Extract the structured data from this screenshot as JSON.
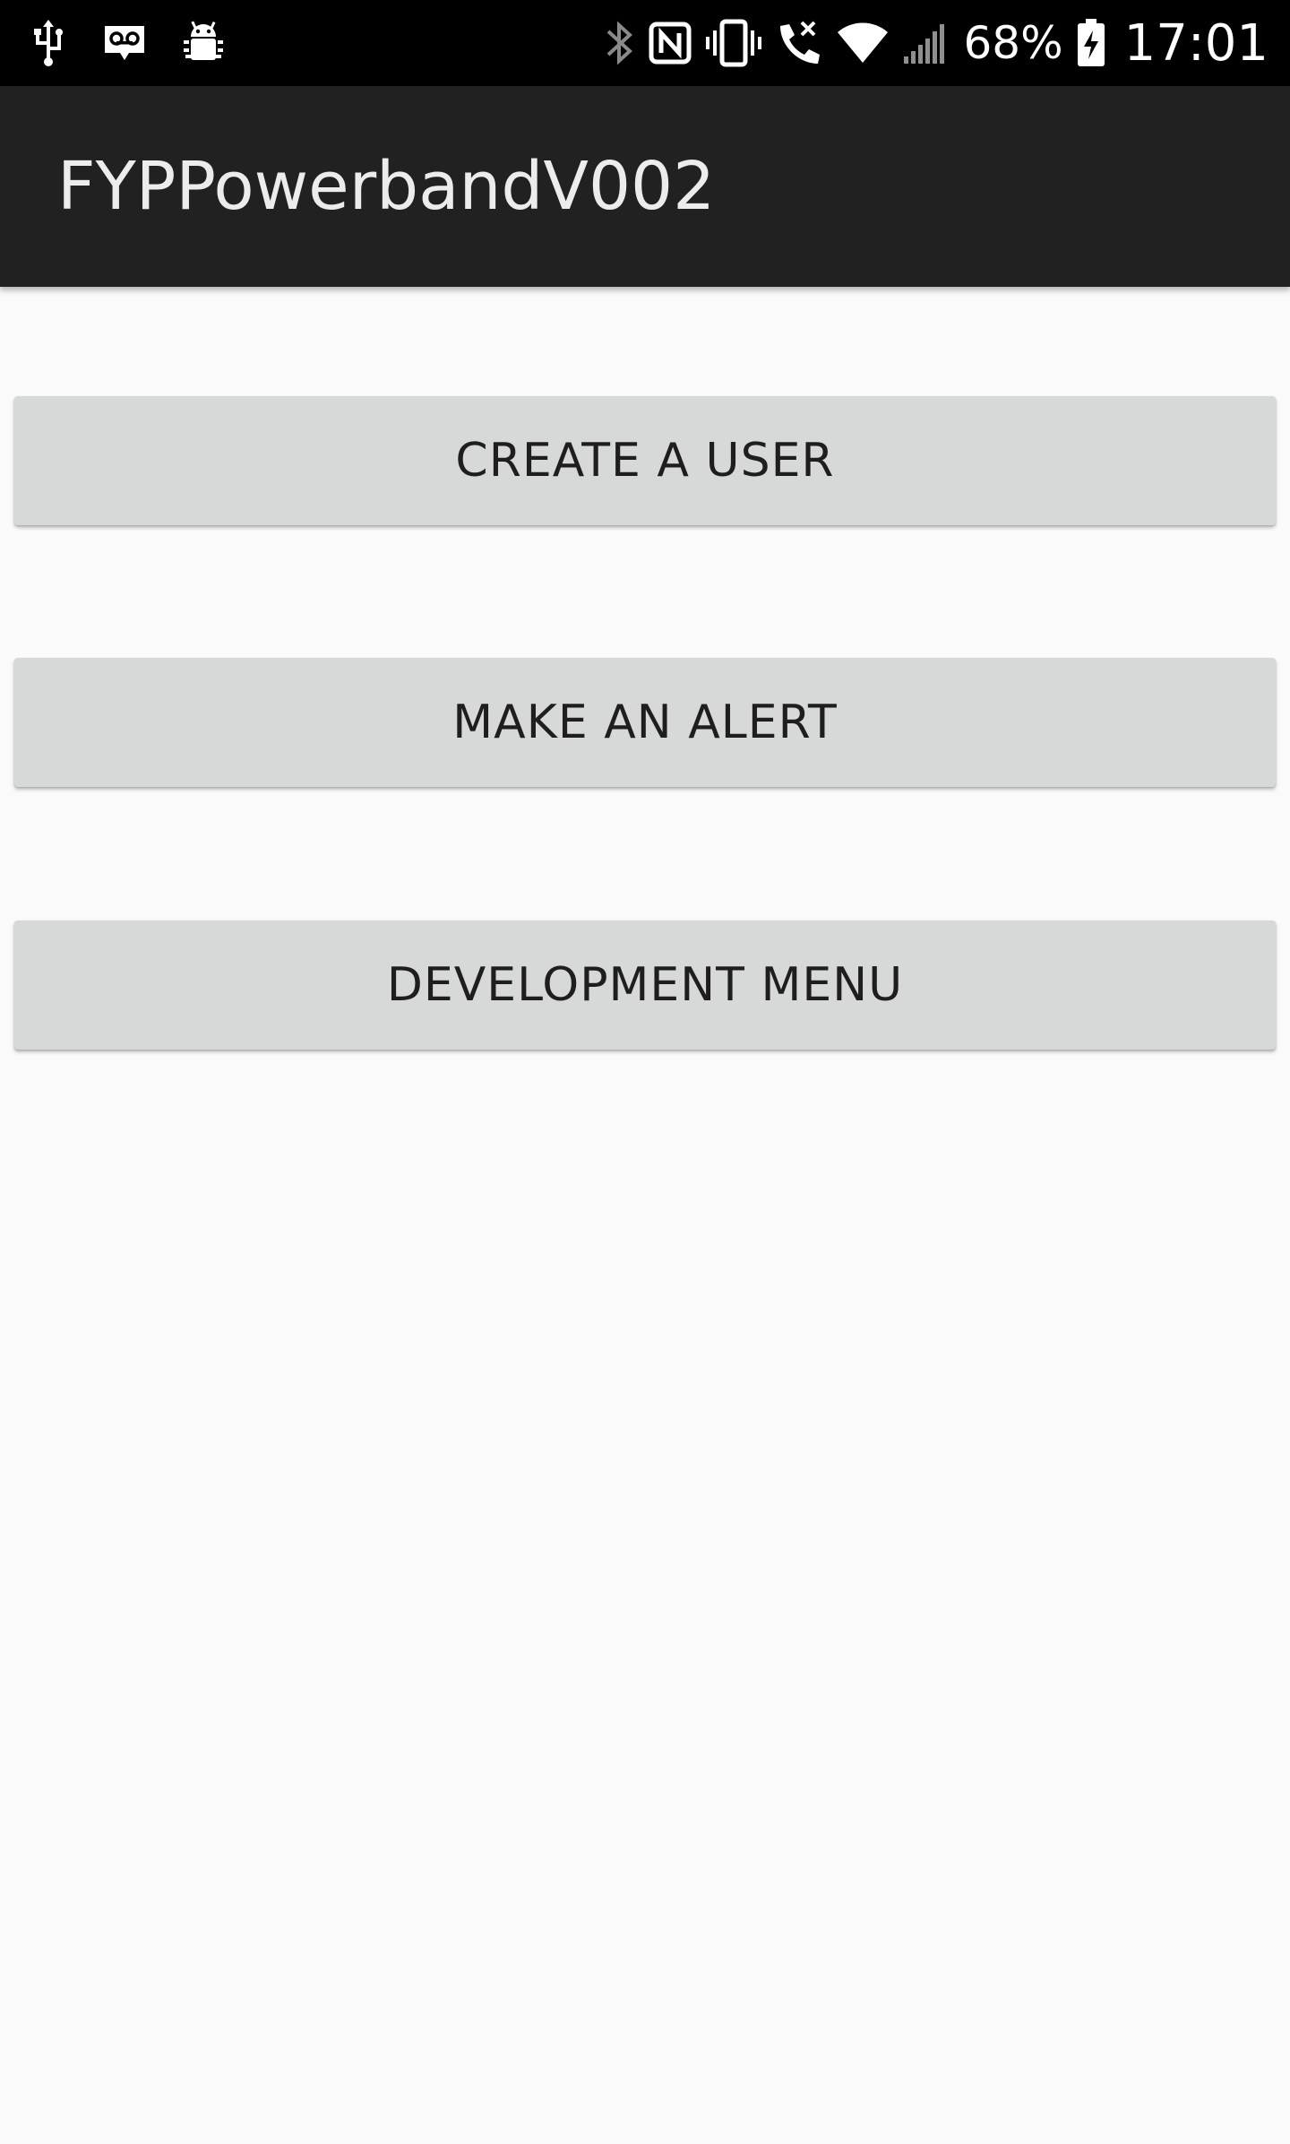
{
  "status_bar": {
    "left_icons": [
      "usb-icon",
      "voicemail-icon",
      "android-debug-icon"
    ],
    "right_icons": [
      "bluetooth-icon",
      "nfc-icon",
      "vibrate-icon",
      "wifi-calling-icon",
      "wifi-icon",
      "signal-icon",
      "battery-charging-icon"
    ],
    "battery_percent": "68%",
    "time": "17:01"
  },
  "app_bar": {
    "title": "FYPPowerbandV002",
    "background": "#212121"
  },
  "main": {
    "buttons": [
      {
        "label": "CREATE A USER"
      },
      {
        "label": "MAKE AN ALERT"
      },
      {
        "label": "DEVELOPMENT MENU"
      }
    ]
  },
  "colors": {
    "status_bar": "#000000",
    "page_background": "#fafafa",
    "button_background": "#d7d8d8",
    "button_text": "#1e1e1e"
  }
}
